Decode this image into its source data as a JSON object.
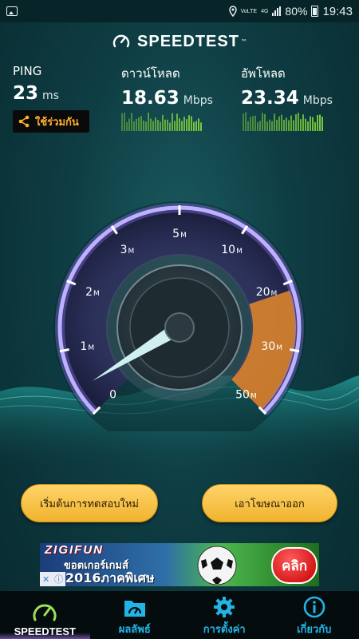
{
  "status_bar": {
    "network_small": "VoLTE",
    "network_type": "4G",
    "battery": "80%",
    "time": "19:43"
  },
  "header": {
    "logo_text": "SPEEDTEST",
    "logo_mark": "™"
  },
  "ping": {
    "label": "PING",
    "value": "23",
    "unit": "ms"
  },
  "download": {
    "label": "ดาวน์โหลด",
    "value": "18.63",
    "unit": "Mbps"
  },
  "upload": {
    "label": "อัพโหลด",
    "value": "23.34",
    "unit": "Mbps"
  },
  "share": {
    "label": "ใช้ร่วมกัน"
  },
  "gauge": {
    "ticks": [
      {
        "label": "0",
        "sub": ""
      },
      {
        "label": "1",
        "sub": "M"
      },
      {
        "label": "2",
        "sub": "M"
      },
      {
        "label": "3",
        "sub": "M"
      },
      {
        "label": "5",
        "sub": "M"
      },
      {
        "label": "10",
        "sub": "M"
      },
      {
        "label": "20",
        "sub": "M"
      },
      {
        "label": "30",
        "sub": "M"
      },
      {
        "label": "50",
        "sub": "M"
      }
    ],
    "needle_value_mbps": 0.4
  },
  "buttons": {
    "restart": "เริ่มต้นการทดสอบใหม่",
    "remove_ads": "เอาโฆษณาออก"
  },
  "ad": {
    "brand": "ZIGIFUN",
    "line1": "ขอตเกอร์เกมส์",
    "line2": "2016ภาคพิเศษ",
    "cta": "คลิก"
  },
  "nav": {
    "items": [
      {
        "label": "SPEEDTEST",
        "icon": "speedometer-icon",
        "active": true
      },
      {
        "label": "ผลลัพธ์",
        "icon": "results-folder-icon",
        "active": false
      },
      {
        "label": "การตั้งค่า",
        "icon": "gear-icon",
        "active": false
      },
      {
        "label": "เกี่ยวกับ",
        "icon": "info-icon",
        "active": false
      }
    ]
  },
  "colors": {
    "accent_blue": "#23b4e6",
    "button_gold": "#f0b32e",
    "gauge_arc": "#b9a4ff",
    "upload_zone": "#ff9a2e",
    "spark_green": "#7fd23a"
  }
}
